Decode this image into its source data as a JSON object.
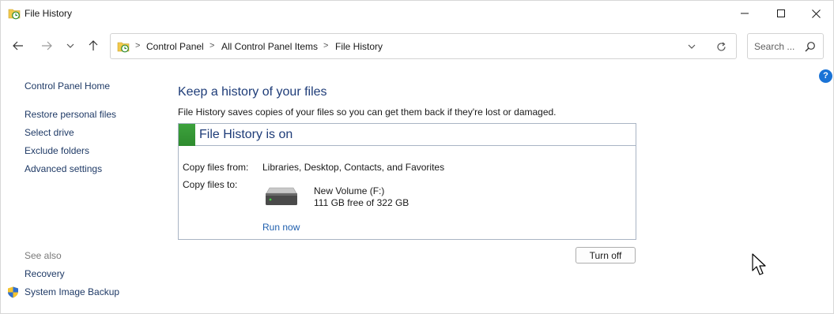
{
  "window": {
    "title": "File History",
    "minimize_icon": "minimize-icon",
    "maximize_icon": "maximize-icon",
    "close_icon": "close-icon"
  },
  "nav": {
    "back_icon": "arrow-left-icon",
    "forward_icon": "arrow-right-icon",
    "recent_icon": "chevron-down-icon",
    "up_icon": "arrow-up-icon"
  },
  "address": {
    "crumbs": [
      "Control Panel",
      "All Control Panel Items",
      "File History"
    ],
    "separator": ">"
  },
  "search": {
    "placeholder": "Search ..."
  },
  "help": {
    "label": "?"
  },
  "sidebar": {
    "items": [
      {
        "label": "Control Panel Home"
      },
      {
        "label": "Restore personal files"
      },
      {
        "label": "Select drive"
      },
      {
        "label": "Exclude folders"
      },
      {
        "label": "Advanced settings"
      }
    ],
    "see_also_label": "See also",
    "see_also": [
      {
        "label": "Recovery"
      },
      {
        "label": "System Image Backup"
      }
    ]
  },
  "main": {
    "heading": "Keep a history of your files",
    "description": "File History saves copies of your files so you can get them back if they're lost or damaged.",
    "status": "File History is on",
    "status_color": "#2e8b2e",
    "copy_from_label": "Copy files from:",
    "copy_from_value": "Libraries, Desktop, Contacts, and Favorites",
    "copy_to_label": "Copy files to:",
    "drive_name": "New Volume (F:)",
    "drive_free": "111 GB free of 322 GB",
    "run_now": "Run now",
    "turn_off": "Turn off"
  }
}
